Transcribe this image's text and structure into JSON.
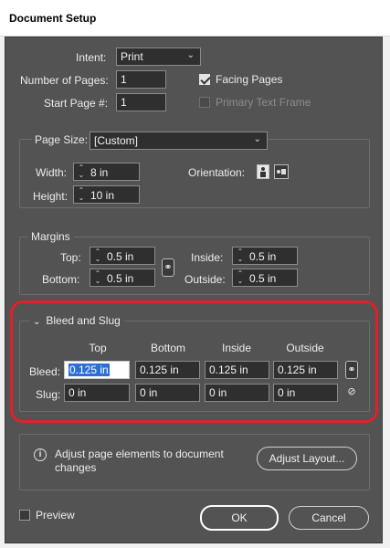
{
  "window": {
    "title": "Document Setup"
  },
  "intent": {
    "label": "Intent:",
    "value": "Print"
  },
  "pages": {
    "label": "Number of Pages:",
    "value": "1"
  },
  "start_page": {
    "label": "Start Page #:",
    "value": "1"
  },
  "facing_pages": {
    "label": "Facing Pages",
    "checked": true
  },
  "primary_text_frame": {
    "label": "Primary Text Frame",
    "checked": false,
    "disabled": true
  },
  "page_size": {
    "label": "Page Size:",
    "value": "[Custom]",
    "width_label": "Width:",
    "width": "8 in",
    "height_label": "Height:",
    "height": "10 in",
    "orientation_label": "Orientation:",
    "orientation": "portrait"
  },
  "margins": {
    "title": "Margins",
    "top_label": "Top:",
    "top": "0.5 in",
    "bottom_label": "Bottom:",
    "bottom": "0.5 in",
    "inside_label": "Inside:",
    "inside": "0.5 in",
    "outside_label": "Outside:",
    "outside": "0.5 in"
  },
  "bleed_slug": {
    "title": "Bleed and Slug",
    "columns": [
      "Top",
      "Bottom",
      "Inside",
      "Outside"
    ],
    "bleed_label": "Bleed:",
    "bleed": [
      "0.125 in",
      "0.125 in",
      "0.125 in",
      "0.125 in"
    ],
    "slug_label": "Slug:",
    "slug": [
      "0 in",
      "0 in",
      "0 in",
      "0 in"
    ]
  },
  "info": {
    "text_line1": "Adjust page elements to document",
    "text_line2": "changes",
    "button": "Adjust Layout..."
  },
  "preview": {
    "label": "Preview",
    "checked": false
  },
  "buttons": {
    "ok": "OK",
    "cancel": "Cancel"
  },
  "colors": {
    "highlight_ring": "#e0202a",
    "dialog_bg": "#535353",
    "selection": "#2d6fd6"
  }
}
